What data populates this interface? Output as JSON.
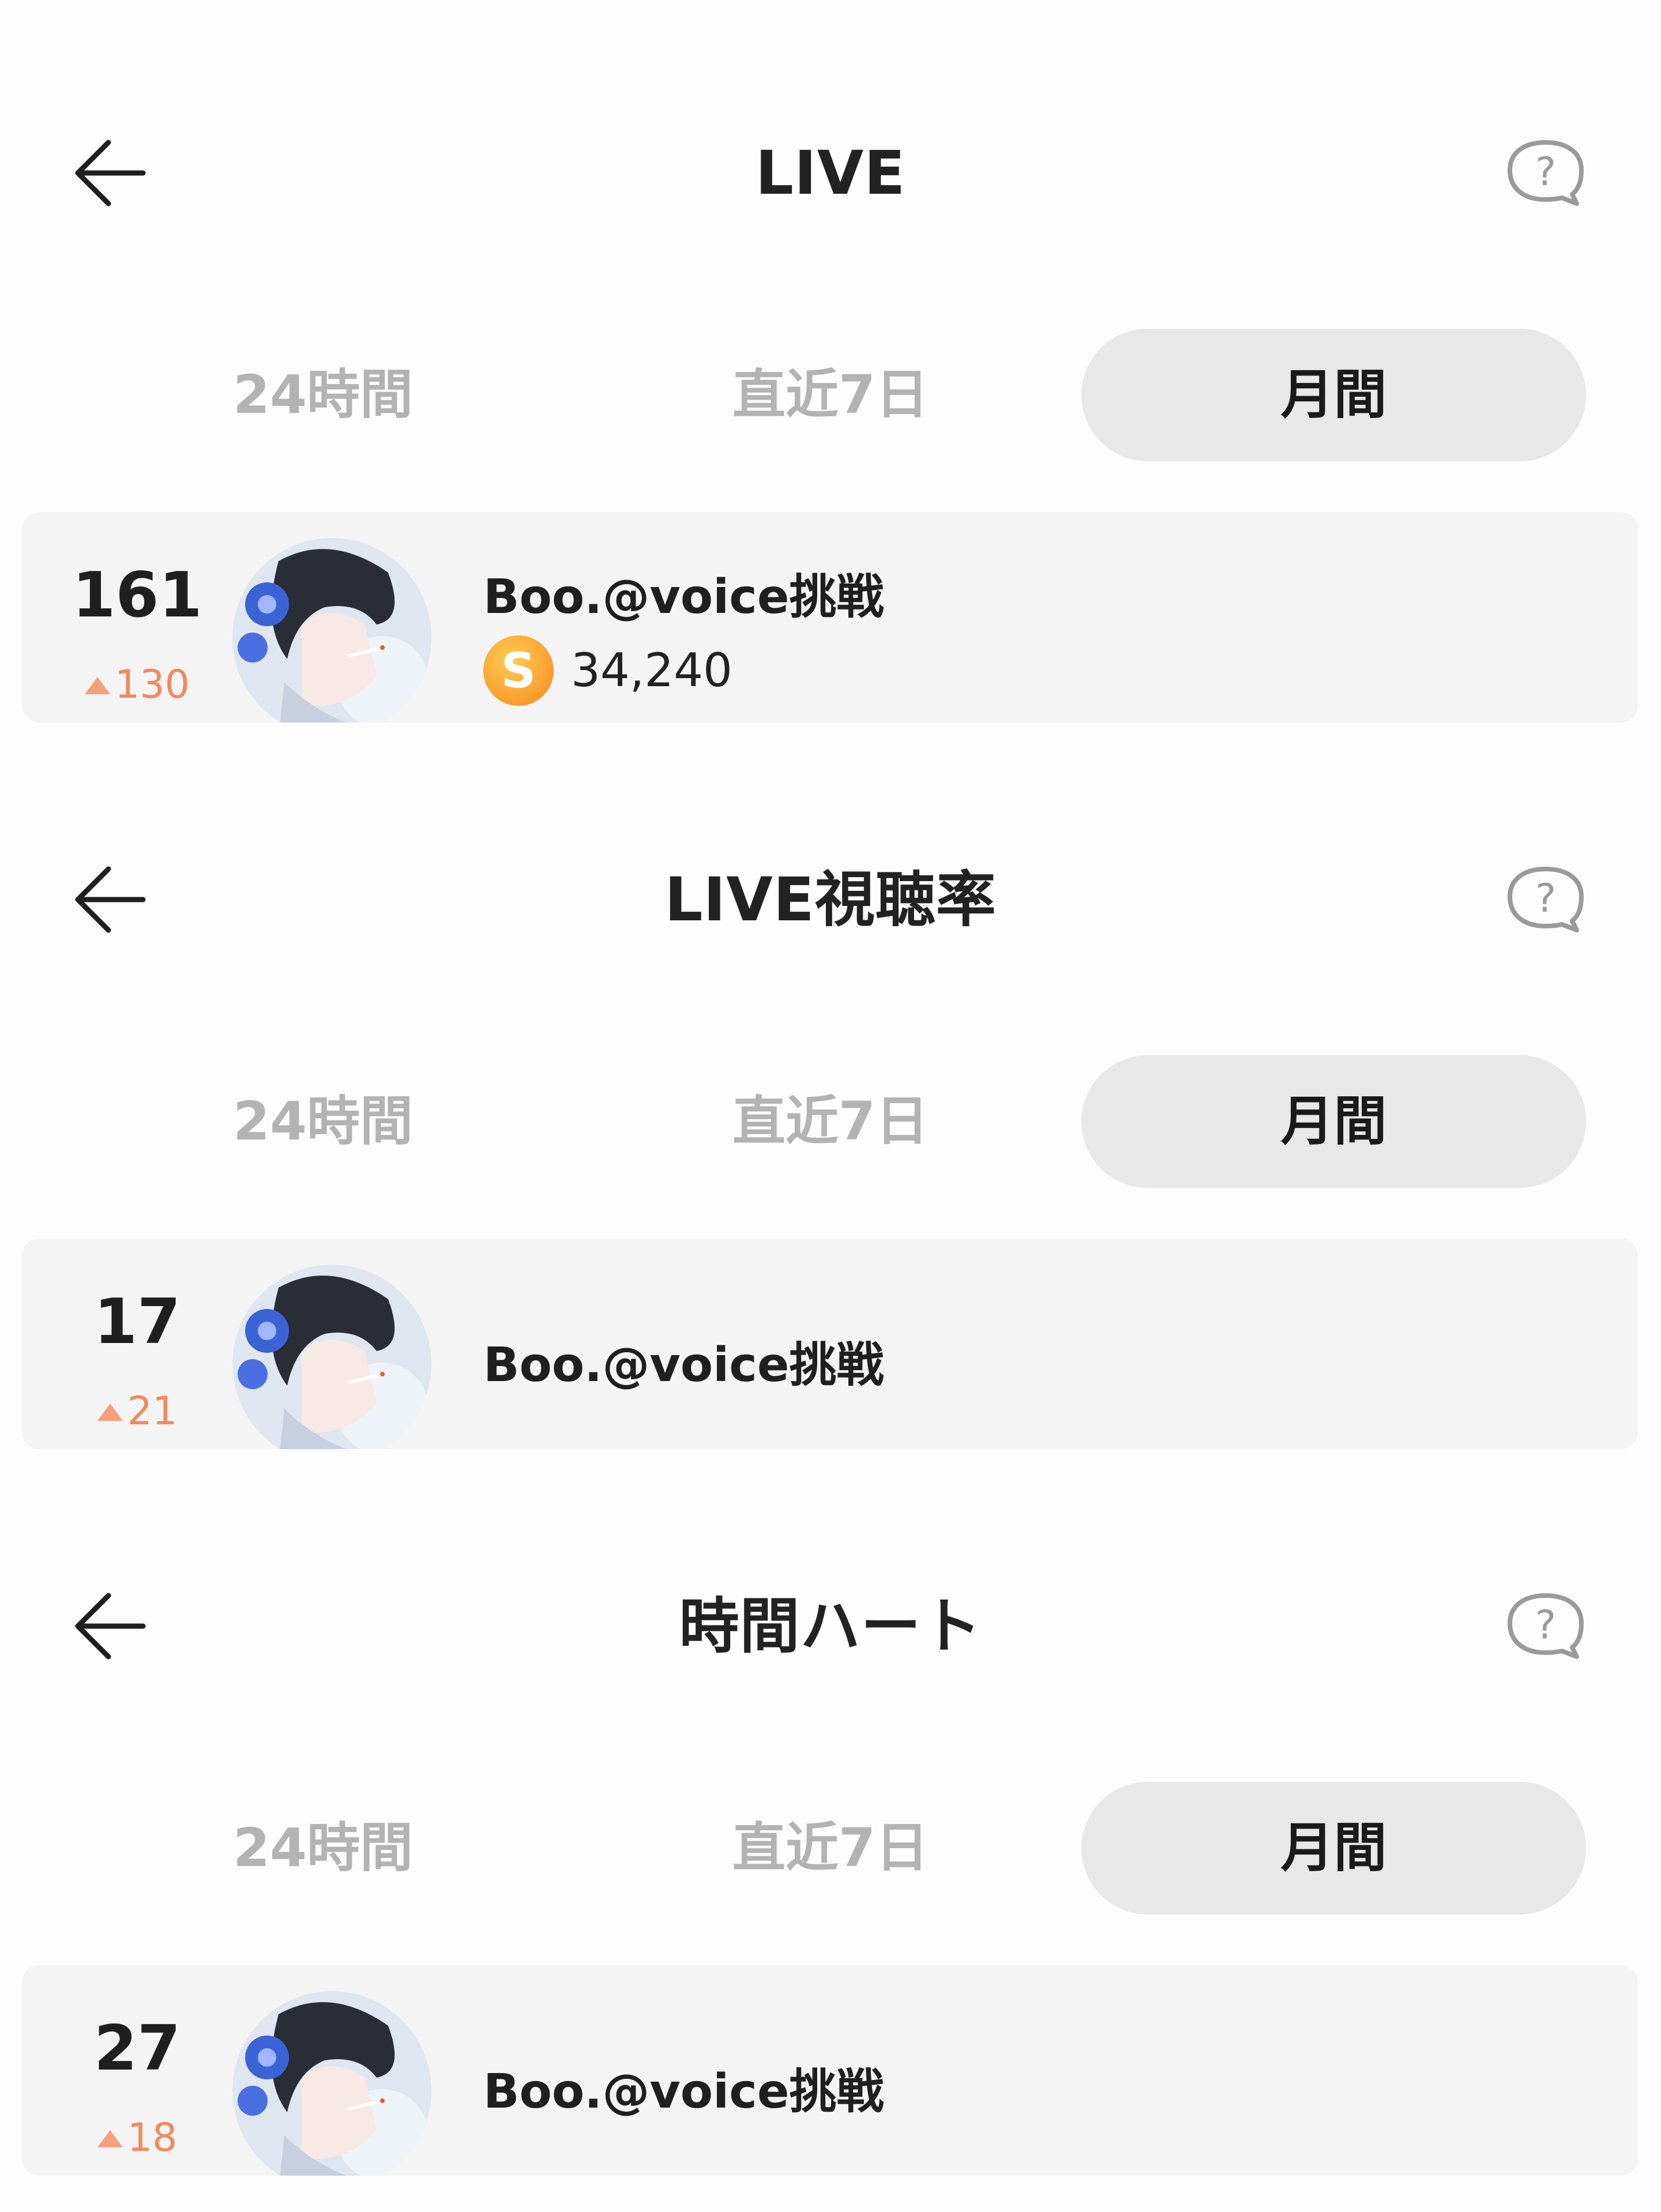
{
  "panels": [
    {
      "title": "LIVE",
      "tabs": [
        "24時間",
        "直近7日",
        "月間"
      ],
      "active_tab": "月間",
      "entry": {
        "rank": "161",
        "rank_change": "130",
        "username": "Boo.@voice挑戦",
        "coin_symbol": "S",
        "coin_value": "34,240"
      }
    },
    {
      "title": "LIVE視聴率",
      "tabs": [
        "24時間",
        "直近7日",
        "月間"
      ],
      "active_tab": "月間",
      "entry": {
        "rank": "17",
        "rank_change": "21",
        "username": "Boo.@voice挑戦"
      }
    },
    {
      "title": "時間ハート",
      "tabs": [
        "24時間",
        "直近7日",
        "月間"
      ],
      "active_tab": "月間",
      "entry": {
        "rank": "27",
        "rank_change": "18",
        "username": "Boo.@voice挑戦"
      }
    }
  ],
  "icons": {
    "back": "arrow-left-icon",
    "help": "question-bubble-icon",
    "rank_up": "triangle-up-icon",
    "coin": "coin-icon"
  },
  "colors": {
    "background": "#fdfdfd",
    "active_tab_bg": "#e8e8e8",
    "inactive_tab_text": "#b3b3b3",
    "row_bg": "#f4f4f4",
    "rank_up": "#f08a5d",
    "coin": "#fba333"
  }
}
